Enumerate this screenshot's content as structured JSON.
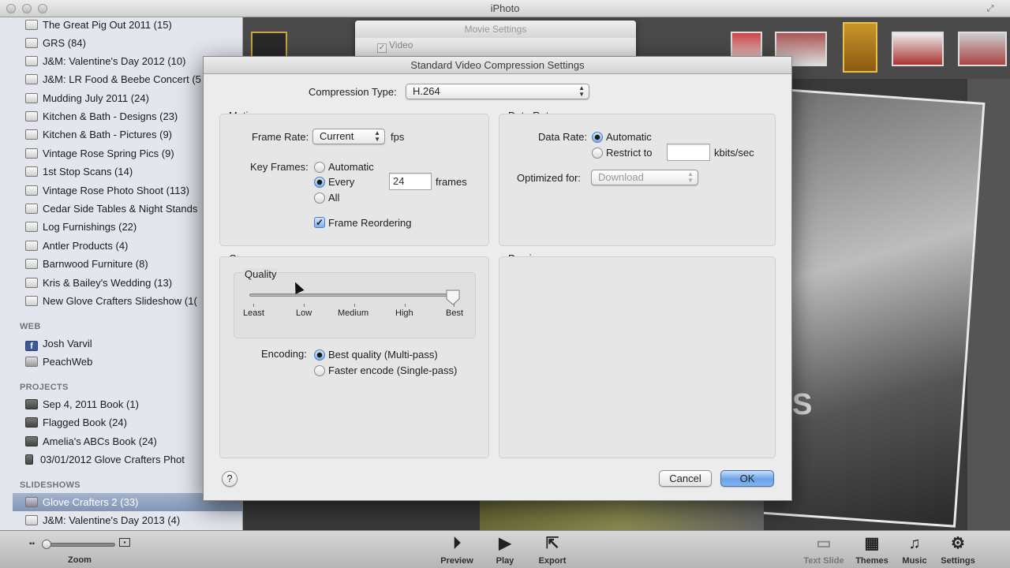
{
  "window": {
    "title": "iPhoto"
  },
  "sidebar": {
    "albums": [
      "The Great Pig Out 2011 (15)",
      "GRS (84)",
      "J&M: Valentine's Day 2012 (10)",
      "J&M: LR Food & Beebe Concert (5",
      "Mudding July 2011 (24)",
      "Kitchen & Bath - Designs (23)",
      "Kitchen & Bath - Pictures (9)",
      "Vintage Rose Spring Pics (9)",
      "1st Stop Scans (14)",
      "Vintage Rose Photo Shoot (113)",
      "Cedar Side Tables & Night Stands",
      "Log Furnishings (22)",
      "Antler Products (4)",
      "Barnwood Furniture (8)",
      "Kris & Bailey's Wedding (13)",
      "New Glove Crafters Slideshow (1("
    ],
    "web_header": "WEB",
    "web": [
      "Josh Varvil",
      "PeachWeb"
    ],
    "projects_header": "PROJECTS",
    "projects": [
      "Sep 4, 2011 Book (1)",
      "Flagged Book (24)",
      "Amelia's ABCs Book (24)",
      "03/01/2012 Glove Crafters Phot"
    ],
    "slideshows_header": "SLIDESHOWS",
    "slideshows": [
      "Glove Crafters 2 (33)",
      "J&M: Valentine's Day 2013 (4)"
    ]
  },
  "movie_settings": {
    "title": "Movie Settings",
    "video_label": "Video"
  },
  "dialog": {
    "title": "Standard Video Compression Settings",
    "compression_type_label": "Compression Type:",
    "compression_type_value": "H.264",
    "motion": {
      "title": "Motion",
      "frame_rate_label": "Frame Rate:",
      "frame_rate_value": "Current",
      "fps_label": "fps",
      "key_frames_label": "Key Frames:",
      "key_frames_options": [
        "Automatic",
        "Every",
        "All"
      ],
      "key_frames_selected": "Every",
      "key_frames_every_value": "24",
      "frames_label": "frames",
      "frame_reordering_label": "Frame Reordering",
      "frame_reordering_checked": true
    },
    "data_rate": {
      "title": "Data Rate",
      "data_rate_label": "Data Rate:",
      "options": [
        "Automatic",
        "Restrict to"
      ],
      "selected": "Automatic",
      "restrict_value": "",
      "unit_label": "kbits/sec",
      "optimized_for_label": "Optimized for:",
      "optimized_for_value": "Download"
    },
    "compressor": {
      "title": "Compressor",
      "quality_label": "Quality",
      "quality_ticks": [
        "Least",
        "Low",
        "Medium",
        "High",
        "Best"
      ],
      "quality_value": 1.0,
      "encoding_label": "Encoding:",
      "encoding_options": [
        "Best quality (Multi-pass)",
        "Faster encode (Single-pass)"
      ],
      "encoding_selected": "Best quality (Multi-pass)"
    },
    "preview": {
      "title": "Preview"
    },
    "help_label": "?",
    "cancel_label": "Cancel",
    "ok_label": "OK"
  },
  "background": {
    "slide_text": "S"
  },
  "toolbar": {
    "zoom_label": "Zoom",
    "preview_label": "Preview",
    "play_label": "Play",
    "export_label": "Export",
    "text_slide_label": "Text Slide",
    "themes_label": "Themes",
    "music_label": "Music",
    "settings_label": "Settings"
  }
}
